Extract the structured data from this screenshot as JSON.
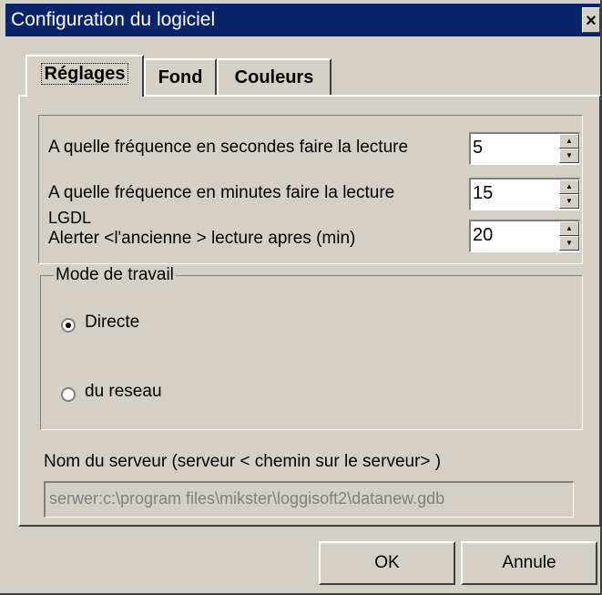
{
  "window": {
    "title": "Configuration du logiciel",
    "close_glyph": "×"
  },
  "tabs": [
    {
      "label": "Réglages",
      "active": true
    },
    {
      "label": "Fond"
    },
    {
      "label": "Couleurs"
    }
  ],
  "settings": {
    "rows": [
      {
        "label": "A quelle fréquence en secondes faire la lecture",
        "value": "5"
      },
      {
        "label": "A quelle fréquence en minutes faire la lecture",
        "value": "15"
      },
      {
        "label_line1": "LGDL",
        "label_line2": "Alerter <l'ancienne > lecture apres (min)",
        "value": "20"
      }
    ]
  },
  "work_mode": {
    "legend": "Mode de travail",
    "options": [
      {
        "label": "Directe",
        "selected": true
      },
      {
        "label": "du reseau",
        "selected": false
      }
    ]
  },
  "server": {
    "label": "Nom du serveur (serveur < chemin sur le serveur> )",
    "value": "serwer:c:\\program files\\mikster\\loggisoft2\\datanew.gdb"
  },
  "buttons": {
    "ok": "OK",
    "cancel": "Annule"
  }
}
